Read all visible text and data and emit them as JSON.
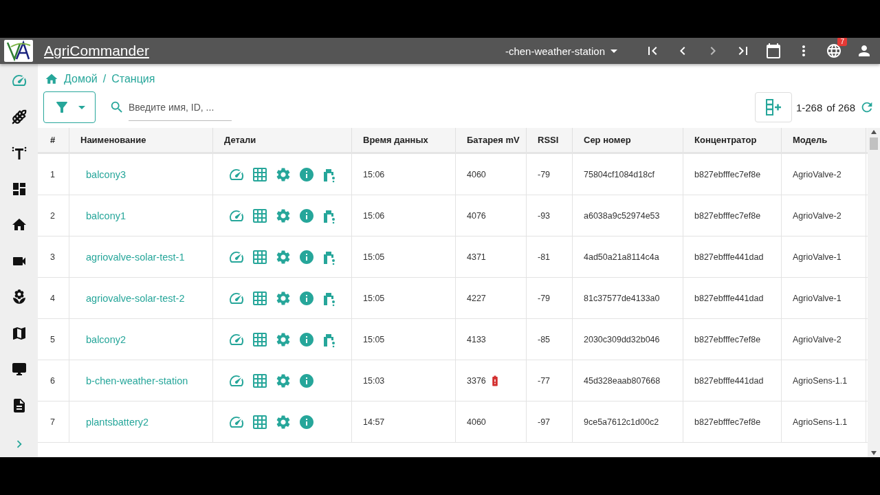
{
  "app": {
    "title": "AgriCommander"
  },
  "station_selector": {
    "value": "-chen-weather-station"
  },
  "notifications": {
    "count": "7"
  },
  "sidebar": {
    "items": [
      {
        "selected": true
      },
      {
        "selected": false
      },
      {
        "selected": false
      },
      {
        "selected": false
      },
      {
        "selected": false
      },
      {
        "selected": false
      },
      {
        "selected": false
      },
      {
        "selected": false
      },
      {
        "selected": false
      },
      {
        "selected": false
      }
    ]
  },
  "breadcrumb": {
    "items": [
      "Домой",
      "Станция"
    ],
    "separator": "/"
  },
  "search": {
    "placeholder": "Введите имя, ID, ..."
  },
  "pagination": {
    "range": "1-268",
    "total": "of 268"
  },
  "table": {
    "columns": [
      "#",
      "Наименование",
      "Детали",
      "Время данных",
      "Батарея mV",
      "RSSI",
      "Сер номер",
      "Концентратор",
      "Модель"
    ],
    "rows": [
      {
        "index": "1",
        "name": "balcony3",
        "valve": true,
        "time": "15:06",
        "battery": "4060",
        "battery_low": false,
        "rssi": "-79",
        "serial": "75804cf1084d18cf",
        "hub": "b827ebfffec7ef8e",
        "model": "AgrioValve-2"
      },
      {
        "index": "2",
        "name": "balcony1",
        "valve": true,
        "time": "15:06",
        "battery": "4076",
        "battery_low": false,
        "rssi": "-93",
        "serial": "a6038a9c52974e53",
        "hub": "b827ebfffec7ef8e",
        "model": "AgrioValve-2"
      },
      {
        "index": "3",
        "name": "agriovalve-solar-test-1",
        "valve": true,
        "time": "15:05",
        "battery": "4371",
        "battery_low": false,
        "rssi": "-81",
        "serial": "4ad50a21a8114c4a",
        "hub": "b827ebfffe441dad",
        "model": "AgrioValve-1"
      },
      {
        "index": "4",
        "name": "agriovalve-solar-test-2",
        "valve": true,
        "time": "15:05",
        "battery": "4227",
        "battery_low": false,
        "rssi": "-79",
        "serial": "81c37577de4133a0",
        "hub": "b827ebfffe441dad",
        "model": "AgrioValve-1"
      },
      {
        "index": "5",
        "name": "balcony2",
        "valve": true,
        "time": "15:05",
        "battery": "4133",
        "battery_low": false,
        "rssi": "-85",
        "serial": "2030c309dd32b046",
        "hub": "b827ebfffec7ef8e",
        "model": "AgrioValve-2"
      },
      {
        "index": "6",
        "name": "b-chen-weather-station",
        "valve": false,
        "time": "15:03",
        "battery": "3376",
        "battery_low": true,
        "rssi": "-77",
        "serial": "45d328eaab807668",
        "hub": "b827ebfffe441dad",
        "model": "AgrioSens-1.1"
      },
      {
        "index": "7",
        "name": "plantsbattery2",
        "valve": false,
        "time": "14:57",
        "battery": "4060",
        "battery_low": false,
        "rssi": "-97",
        "serial": "9ce5a7612c1d00c2",
        "hub": "b827ebfffec7ef8e",
        "model": "AgrioSens-1.1"
      }
    ]
  }
}
